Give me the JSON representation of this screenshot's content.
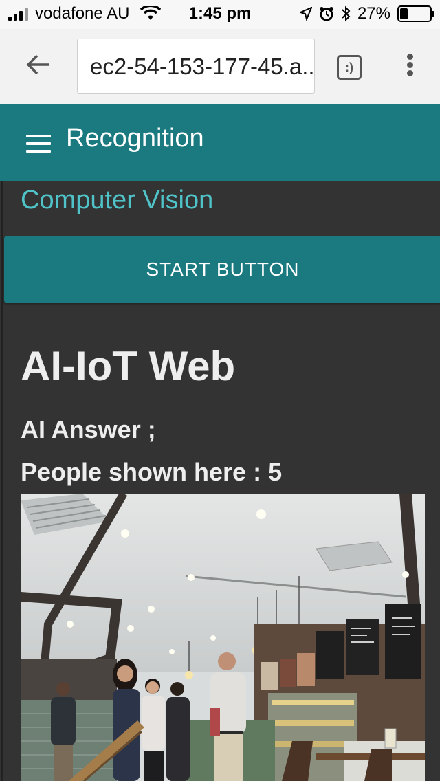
{
  "status_bar": {
    "carrier": "vodafone AU",
    "time": "1:45 pm",
    "battery_percent": "27%",
    "battery_level": 0.27,
    "icons": [
      "signal-icon",
      "wifi-icon",
      "location-icon",
      "alarm-icon",
      "bluetooth-icon",
      "battery-icon"
    ]
  },
  "browser": {
    "url": "ec2-54-153-177-45.a...",
    "tab_switcher_label": ":)",
    "icons": [
      "back-arrow-icon",
      "overflow-menu-icon"
    ]
  },
  "app_header": {
    "title": "Recognition",
    "menu_icon": "hamburger-icon",
    "color": "#1a7a80"
  },
  "content": {
    "section_label": "Computer Vision",
    "start_button_label": "START BUTTON",
    "heading": "AI-IoT Web",
    "ai_answer": "AI Answer ;",
    "people_count_text": "People shown here : 5"
  },
  "colors": {
    "accent": "#1a7a80",
    "accent_text": "#4fc3c8",
    "background": "#333333"
  }
}
